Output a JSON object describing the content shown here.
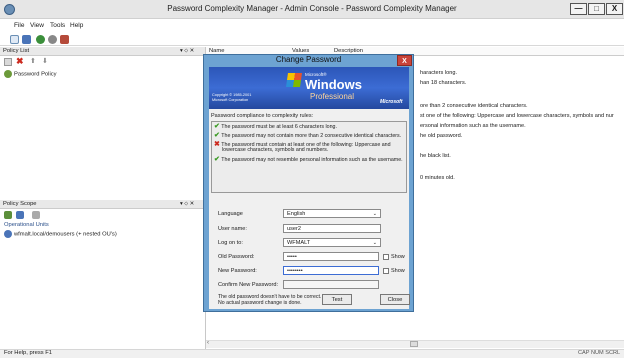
{
  "window": {
    "title": "Password Complexity Manager - Admin Console - Password Complexity Manager",
    "minimize": "—",
    "maximize": "□",
    "close": "X"
  },
  "menu": [
    "File",
    "View",
    "Tools",
    "Help"
  ],
  "policy_list": {
    "title": "Policy List",
    "controls": "▾ ⬦ ✕",
    "items": [
      "Password Policy"
    ]
  },
  "policy_scope": {
    "title": "Policy Scope",
    "controls": "▾ ⬦ ✕",
    "heading": "Operational Units",
    "items": [
      "wfmalt.local/demousers (+ nested OU's)"
    ]
  },
  "list": {
    "columns": [
      "Name",
      "Values",
      "Description"
    ],
    "descriptions": [
      "haracters long.",
      "han 18 characters.",
      "ore than 2 consecutive identical characters.",
      "st one of the following: Uppercase and lowercase characters, symbols and nur",
      "ersonal information such as the username.",
      "he old password.",
      "he black list.",
      "0 minutes old."
    ]
  },
  "dialog": {
    "title": "Change Password",
    "close": "X",
    "banner": {
      "microsoft_small": "Microsoft®",
      "windows": "Windows",
      "edition": "Professional",
      "copyright": "Copyright © 1985-2001",
      "corp": "Microsoft Corporation",
      "brand": "Microsoft"
    },
    "rules_title": "Password compliance to complexity rules:",
    "rules": [
      {
        "ok": true,
        "text": "The password must be at least 6 characters long."
      },
      {
        "ok": true,
        "text": "The password may not contain more than 2 consecutive identical characters."
      },
      {
        "ok": false,
        "text": "The password must contain at least one of the following: Uppercase and",
        "text2": "lowercase characters, symbols and numbers."
      },
      {
        "ok": true,
        "text": "The password may not resemble personal information such as the username."
      }
    ],
    "language_label": "Language",
    "language_value": "English",
    "username_label": "User name:",
    "username_value": "user2",
    "logon_label": "Log on to:",
    "logon_value": "WFMALT",
    "old_label": "Old Password:",
    "old_value": "•••••",
    "new_label": "New Password:",
    "new_value": "••••••••",
    "confirm_label": "Confirm New Password:",
    "show_label": "Show",
    "note1": "The old password doesn't have to be correct.",
    "note2": "No actual password change is done.",
    "test_button": "Test",
    "close_button": "Close"
  },
  "status": {
    "left": "For Help, press F1",
    "right": "CAP NUM SCRL"
  }
}
